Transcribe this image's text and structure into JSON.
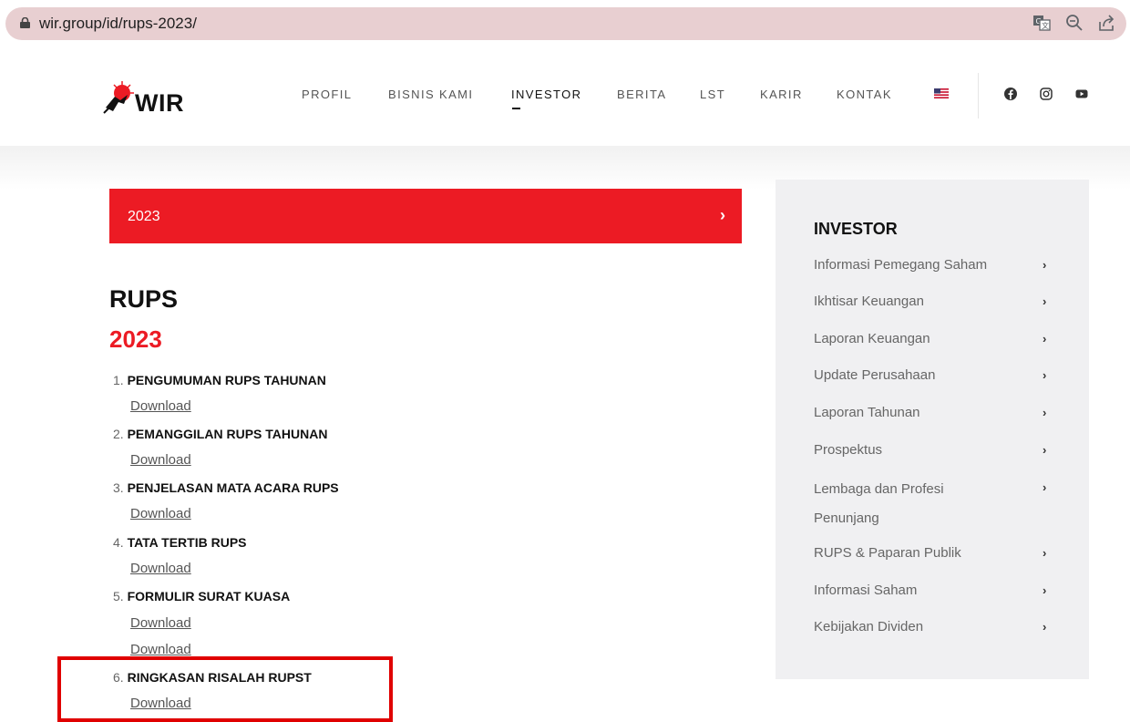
{
  "browser": {
    "url": "wir.group/id/rups-2023/"
  },
  "header": {
    "logo_text": "WIR",
    "nav": [
      "PROFIL",
      "BISNIS KAMI",
      "INVESTOR",
      "BERITA",
      "LST",
      "KARIR",
      "KONTAK"
    ],
    "active_nav": "INVESTOR"
  },
  "main": {
    "year_bar": "2023",
    "year_bar_chevron": "›",
    "title": "RUPS",
    "subtitle": "2023",
    "documents": [
      {
        "num": "1.",
        "title": "PENGUMUMAN RUPS TAHUNAN",
        "links": [
          "Download"
        ]
      },
      {
        "num": "2.",
        "title": "PEMANGGILAN RUPS TAHUNAN",
        "links": [
          "Download"
        ]
      },
      {
        "num": "3.",
        "title": "PENJELASAN MATA ACARA RUPS",
        "links": [
          "Download"
        ]
      },
      {
        "num": "4.",
        "title": "TATA TERTIB RUPS",
        "links": [
          "Download"
        ]
      },
      {
        "num": "5.",
        "title": "FORMULIR SURAT KUASA",
        "links": [
          "Download",
          "Download"
        ]
      },
      {
        "num": "6.",
        "title": "RINGKASAN RISALAH RUPST",
        "links": [
          "Download"
        ]
      }
    ]
  },
  "sidebar": {
    "title": "INVESTOR",
    "items": [
      "Informasi Pemegang Saham",
      "Ikhtisar Keuangan",
      "Laporan Keuangan",
      "Update Perusahaan",
      "Laporan Tahunan",
      "Prospektus",
      "Lembaga dan Profesi Penunjang",
      "RUPS & Paparan Publik",
      "Informasi Saham",
      "Kebijakan Dividen"
    ],
    "chevron": "›"
  },
  "colors": {
    "brand_red": "#ec1b24",
    "sidebar_bg": "#f0f0f2",
    "highlight_box": "#e00000"
  },
  "icons": [
    "lock-icon",
    "translate-icon",
    "zoom-icon",
    "share-icon",
    "us-flag-icon",
    "facebook-icon",
    "instagram-icon",
    "youtube-icon"
  ]
}
